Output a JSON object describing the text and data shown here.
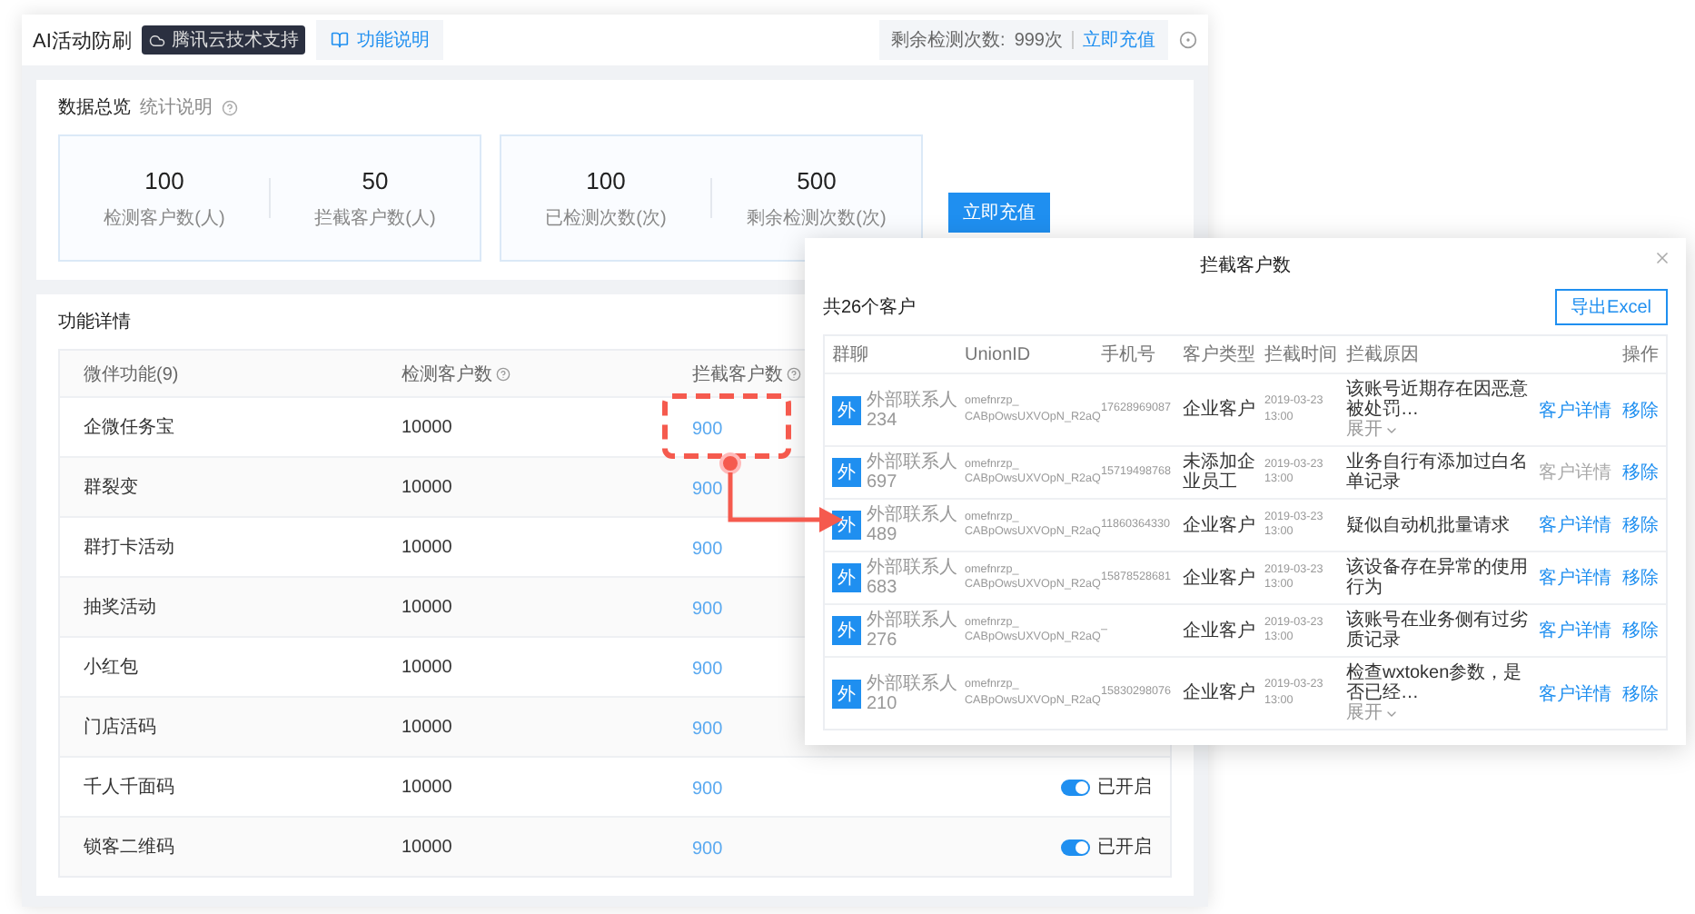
{
  "header": {
    "title": "AI活动防刷",
    "badge": "腾讯云技术支持",
    "tab": "功能说明",
    "quota_label": "剩余检测次数:",
    "quota_value": "999次",
    "recharge_link": "立即充值"
  },
  "overview": {
    "title": "数据总览",
    "hint": "统计说明",
    "groups": [
      [
        {
          "value": "100",
          "label": "检测客户数(人)"
        },
        {
          "value": "50",
          "label": "拦截客户数(人)"
        }
      ],
      [
        {
          "value": "100",
          "label": "已检测次数(次)"
        },
        {
          "value": "500",
          "label": "剩余检测次数(次)"
        }
      ]
    ],
    "recharge_button": "立即充值"
  },
  "details": {
    "title": "功能详情",
    "columns": [
      {
        "label": "微伴功能(9)",
        "help": false
      },
      {
        "label": "检测客户数",
        "help": true
      },
      {
        "label": "拦截客户数",
        "help": true
      }
    ],
    "rows": [
      {
        "name": "企微任务宝",
        "detected": "10000",
        "blocked": "900"
      },
      {
        "name": "群裂变",
        "detected": "10000",
        "blocked": "900"
      },
      {
        "name": "群打卡活动",
        "detected": "10000",
        "blocked": "900"
      },
      {
        "name": "抽奖活动",
        "detected": "10000",
        "blocked": "900"
      },
      {
        "name": "小红包",
        "detected": "10000",
        "blocked": "900"
      },
      {
        "name": "门店活码",
        "detected": "10000",
        "blocked": "900"
      },
      {
        "name": "千人千面码",
        "detected": "10000",
        "blocked": "900",
        "switch": {
          "on": true,
          "label": "已开启"
        }
      },
      {
        "name": "锁客二维码",
        "detected": "10000",
        "blocked": "900",
        "switch": {
          "on": true,
          "label": "已开启"
        }
      }
    ]
  },
  "dialog": {
    "title": "拦截客户数",
    "count": "共26个客户",
    "export_button": "导出Excel",
    "columns": [
      "群聊",
      "UnionID",
      "手机号",
      "客户类型",
      "拦截时间",
      "拦截原因",
      "操作"
    ],
    "rows": [
      {
        "avatar": "外",
        "name": "外部联系人",
        "number": "234",
        "union_id": [
          "omefnrzp_",
          "CABpOwsUXVOpN_R2aQ"
        ],
        "phone": "17628969087",
        "type": "企业客户",
        "date": "2019-03-23",
        "time": "13:00",
        "reason": "该账号近期存在因恶意被处罚…",
        "expand": "展开",
        "detail": "客户详情",
        "detail_enabled": true,
        "remove": "移除"
      },
      {
        "avatar": "外",
        "name": "外部联系人",
        "number": "697",
        "union_id": [
          "omefnrzp_",
          "CABpOwsUXVOpN_R2aQ"
        ],
        "phone": "15719498768",
        "type": "未添加企业员工",
        "date": "2019-03-23",
        "time": "13:00",
        "reason": "业务自行有添加过白名单记录",
        "detail": "客户详情",
        "detail_enabled": false,
        "remove": "移除"
      },
      {
        "avatar": "外",
        "name": "外部联系人",
        "number": "489",
        "union_id": [
          "omefnrzp_",
          "CABpOwsUXVOpN_R2aQ"
        ],
        "phone": "11860364330",
        "type": "企业客户",
        "date": "2019-03-23",
        "time": "13:00",
        "reason": "疑似自动机批量请求",
        "detail": "客户详情",
        "detail_enabled": true,
        "remove": "移除"
      },
      {
        "avatar": "外",
        "name": "外部联系人",
        "number": "683",
        "union_id": [
          "omefnrzp_",
          "CABpOwsUXVOpN_R2aQ"
        ],
        "phone": "15878528681",
        "type": "企业客户",
        "date": "2019-03-23",
        "time": "13:00",
        "reason": "该设备存在异常的使用行为",
        "detail": "客户详情",
        "detail_enabled": true,
        "remove": "移除"
      },
      {
        "avatar": "外",
        "name": "外部联系人",
        "number": "276",
        "union_id": [
          "omefnrzp_",
          "CABpOwsUXVOpN_R2aQ"
        ],
        "phone": "–",
        "type": "企业客户",
        "date": "2019-03-23",
        "time": "13:00",
        "reason": "该账号在业务侧有过劣质记录",
        "detail": "客户详情",
        "detail_enabled": true,
        "remove": "移除"
      },
      {
        "avatar": "外",
        "name": "外部联系人",
        "number": "210",
        "union_id": [
          "omefnrzp_",
          "CABpOwsUXVOpN_R2aQ"
        ],
        "phone": "15830298076",
        "type": "企业客户",
        "date": "2019-03-23",
        "time": "13:00",
        "reason": "检查wxtoken参数，是否已经…",
        "expand": "展开",
        "detail": "客户详情",
        "detail_enabled": true,
        "remove": "移除"
      }
    ]
  }
}
